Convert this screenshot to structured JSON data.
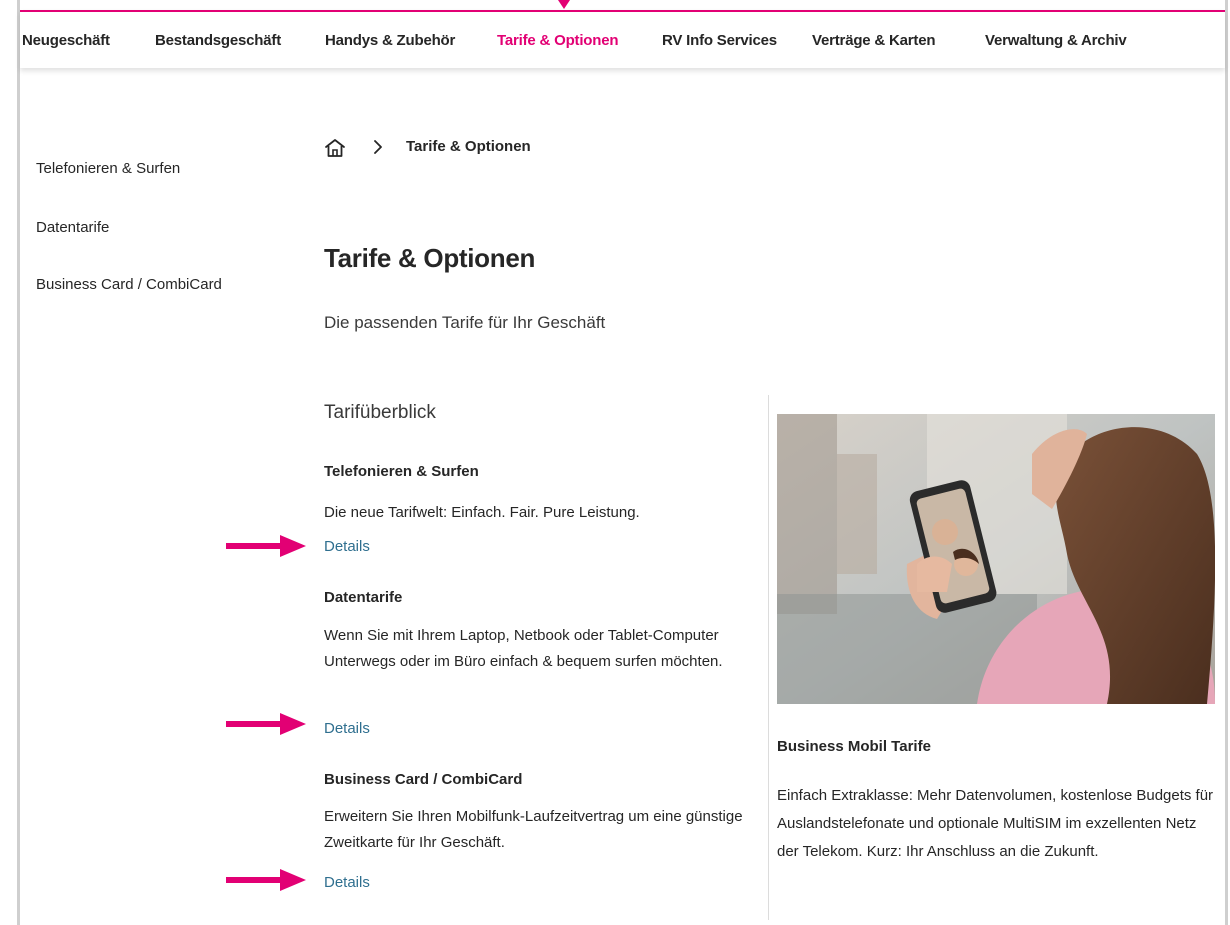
{
  "nav": {
    "items": [
      {
        "label": "Neugeschäft"
      },
      {
        "label": "Bestandsgeschäft"
      },
      {
        "label": "Handys & Zubehör"
      },
      {
        "label": "Tarife & Optionen"
      },
      {
        "label": "RV Info Services"
      },
      {
        "label": "Verträge & Karten"
      },
      {
        "label": "Verwaltung & Archiv"
      }
    ],
    "active_index": 3
  },
  "sidebar": {
    "items": [
      {
        "label": "Telefonieren & Surfen"
      },
      {
        "label": "Datentarife"
      },
      {
        "label": "Business Card / CombiCard"
      }
    ]
  },
  "breadcrumb": {
    "current": "Tarife & Optionen"
  },
  "page": {
    "title": "Tarife & Optionen",
    "subtitle": "Die passenden Tarife für Ihr Geschäft"
  },
  "overview": {
    "title": "Tarifüberblick",
    "tariffs": [
      {
        "title": "Telefonieren & Surfen",
        "description": "Die neue Tarifwelt: Einfach. Fair. Pure Leistung.",
        "link": "Details"
      },
      {
        "title": "Datentarife",
        "description": "Wenn Sie mit Ihrem Laptop, Netbook oder Tablet-Computer Unterwegs oder im Büro einfach & bequem surfen möchten.",
        "link": "Details"
      },
      {
        "title": "Business Card / CombiCard",
        "description": "Erweitern Sie Ihren Mobilfunk-Laufzeitvertrag um eine günstige Zweitkarte für Ihr Geschäft.",
        "link": "Details"
      }
    ]
  },
  "teaser": {
    "title": "Business Mobil Tarife",
    "description": "Einfach Extraklasse: Mehr Datenvolumen, kostenlose Budgets für Auslandstelefonate und optionale MultiSIM im exzellenten Netz der Telekom. Kurz: Ihr Anschluss an die Zukunft."
  },
  "colors": {
    "accent": "#e20074",
    "link": "#2f6f8f",
    "text": "#262626"
  }
}
